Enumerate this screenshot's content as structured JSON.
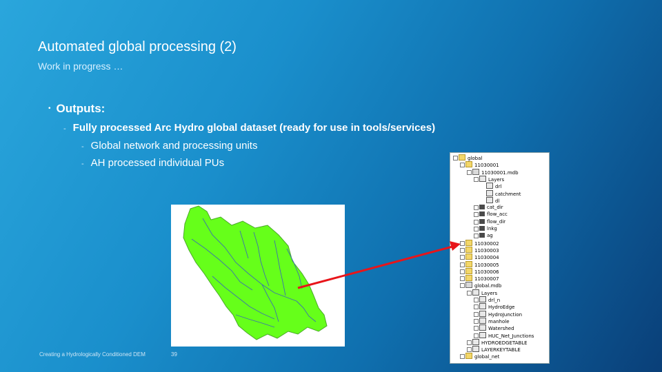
{
  "slide": {
    "title": "Automated global processing (2)",
    "subtitle": "Work in progress …",
    "bullet_level1": "Outputs:",
    "bullet_level2": "Fully processed Arc Hydro global dataset (ready for use in tools/services)",
    "bullet_level3": [
      "Global network and processing units",
      "AH processed individual PUs"
    ],
    "footer": "Creating a Hydrologically Conditioned DEM",
    "page_number": "39"
  },
  "catalog_tree": {
    "items": [
      {
        "label": "global",
        "icon": "folder-icon"
      },
      {
        "label": "11030001",
        "icon": "folder-icon"
      },
      {
        "label": "11030001.mdb",
        "icon": "database-icon"
      },
      {
        "label": "Layers",
        "icon": "layer-icon"
      },
      {
        "label": "drl",
        "icon": "layer-icon"
      },
      {
        "label": "catchment",
        "icon": "layer-icon"
      },
      {
        "label": "dl",
        "icon": "layer-icon"
      },
      {
        "label": "cat_dir",
        "icon": "grid-icon"
      },
      {
        "label": "flow_acc",
        "icon": "grid-icon"
      },
      {
        "label": "flow_dir",
        "icon": "grid-icon"
      },
      {
        "label": "lnkg",
        "icon": "grid-icon"
      },
      {
        "label": "ag",
        "icon": "grid-icon"
      },
      {
        "label": "11030002",
        "icon": "folder-icon"
      },
      {
        "label": "11030003",
        "icon": "folder-icon"
      },
      {
        "label": "11030004",
        "icon": "folder-icon"
      },
      {
        "label": "11030005",
        "icon": "folder-icon"
      },
      {
        "label": "11030006",
        "icon": "folder-icon"
      },
      {
        "label": "11030007",
        "icon": "folder-icon"
      },
      {
        "label": "global.mdb",
        "icon": "database-icon"
      },
      {
        "label": "Layers",
        "icon": "layer-icon"
      },
      {
        "label": "drl_n",
        "icon": "layer-icon"
      },
      {
        "label": "HydroEdge",
        "icon": "layer-icon"
      },
      {
        "label": "HydroJunction",
        "icon": "layer-icon"
      },
      {
        "label": "manhole",
        "icon": "layer-icon"
      },
      {
        "label": "Watershed",
        "icon": "layer-icon"
      },
      {
        "label": "HUC_Net_Junctions",
        "icon": "layer-icon"
      },
      {
        "label": "HYDROEDGETABLE",
        "icon": "table-icon"
      },
      {
        "label": "LAYERKEYTABLE",
        "icon": "table-icon"
      },
      {
        "label": "global_net",
        "icon": "folder-icon"
      }
    ]
  },
  "colors": {
    "watershed_fill": "#66ff1a",
    "stream_lines": "#3a6fb0",
    "arrow": "#e8151a"
  }
}
